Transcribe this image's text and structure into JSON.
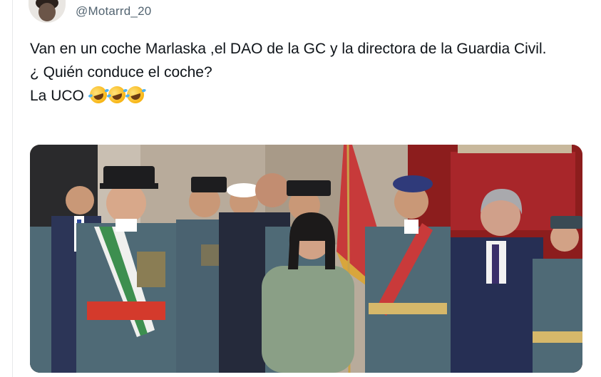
{
  "tweet": {
    "handle": "@Motarrd_20",
    "lines": [
      "Van en un coche Marlaska ,el DAO de la GC y la directora de la Guardia Civil.",
      "¿ Quién conduce el coche?",
      "La UCO"
    ],
    "emoji": [
      "rolling-on-floor-laughing-emoji",
      "rolling-on-floor-laughing-emoji",
      "rolling-on-floor-laughing-emoji"
    ]
  },
  "colors": {
    "uniform": "#4f6a76",
    "sash_red": "#d43a2c",
    "flag": "#c73a3a",
    "curtain": "#8c1d1d",
    "wall": "#b8ab9b"
  }
}
